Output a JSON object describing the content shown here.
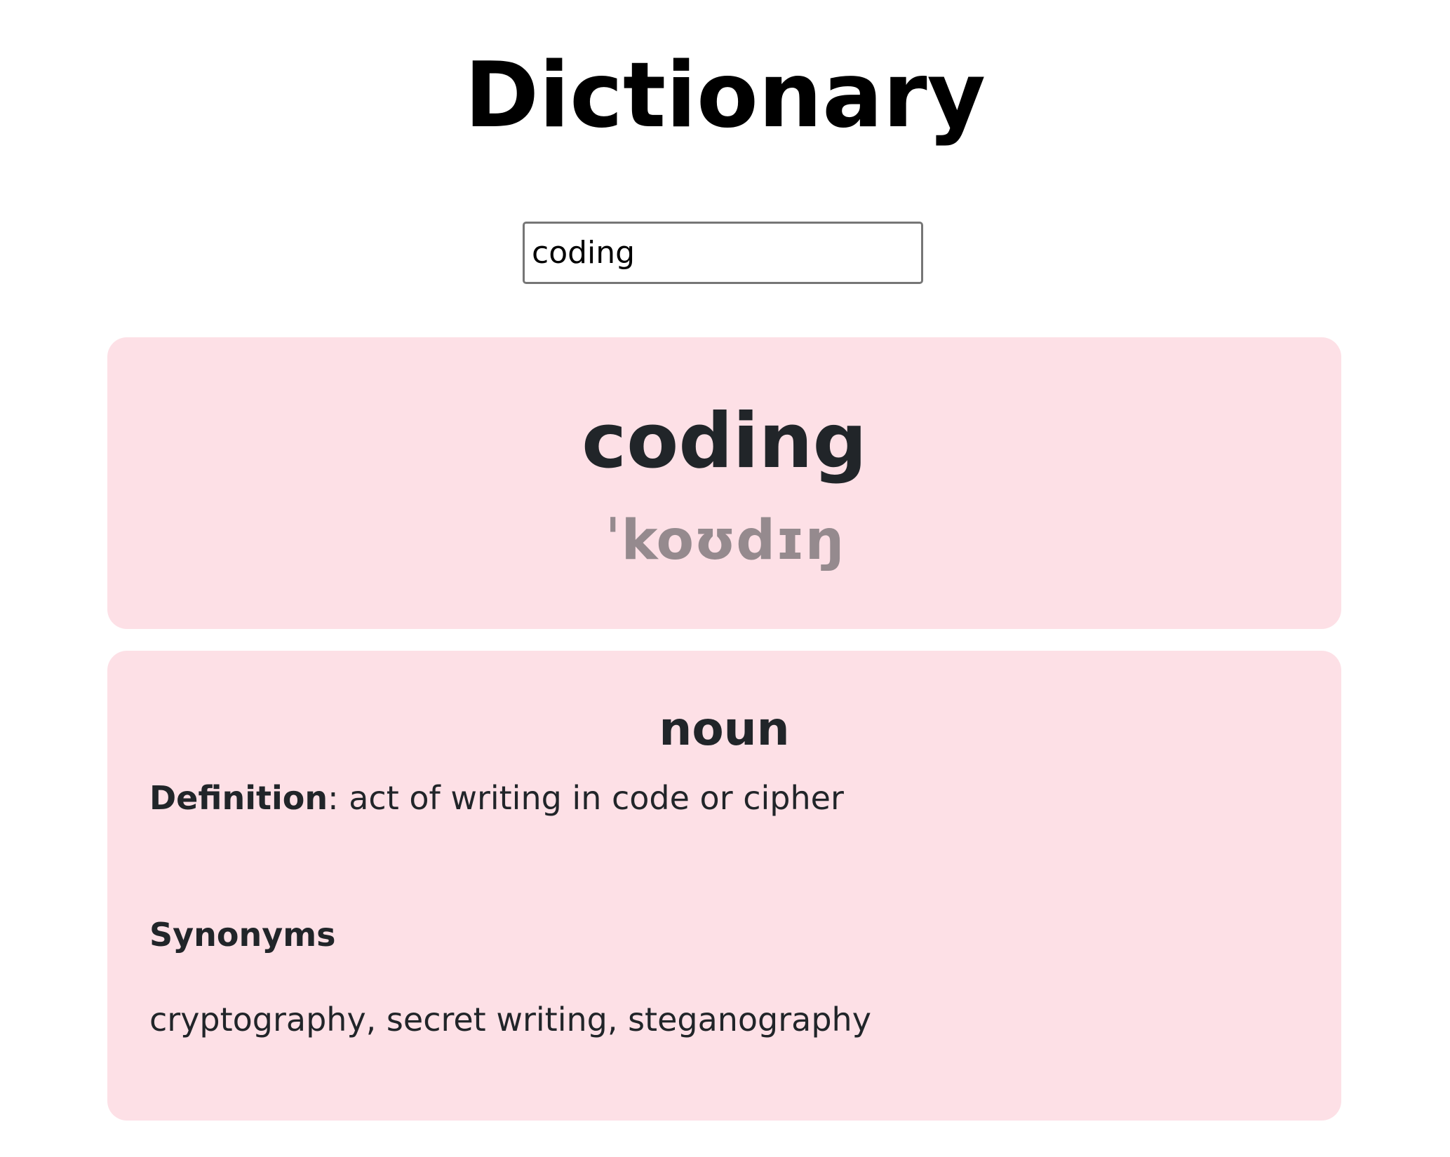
{
  "header": {
    "title": "Dictionary"
  },
  "search": {
    "value": "coding",
    "placeholder": ""
  },
  "word_card": {
    "word": "coding",
    "phonetic": "ˈkoʊdɪŋ"
  },
  "meaning_card": {
    "part_of_speech": "noun",
    "definition_label": "Definition",
    "definition_separator": ":",
    "definition_text": " act of writing in code or cipher",
    "synonyms_heading": "Synonyms",
    "synonyms": "cryptography, secret writing, steganography"
  },
  "colors": {
    "card_background": "#fde0e6",
    "text": "#212529",
    "phonetic": "#958a8e",
    "input_border": "#767676"
  }
}
